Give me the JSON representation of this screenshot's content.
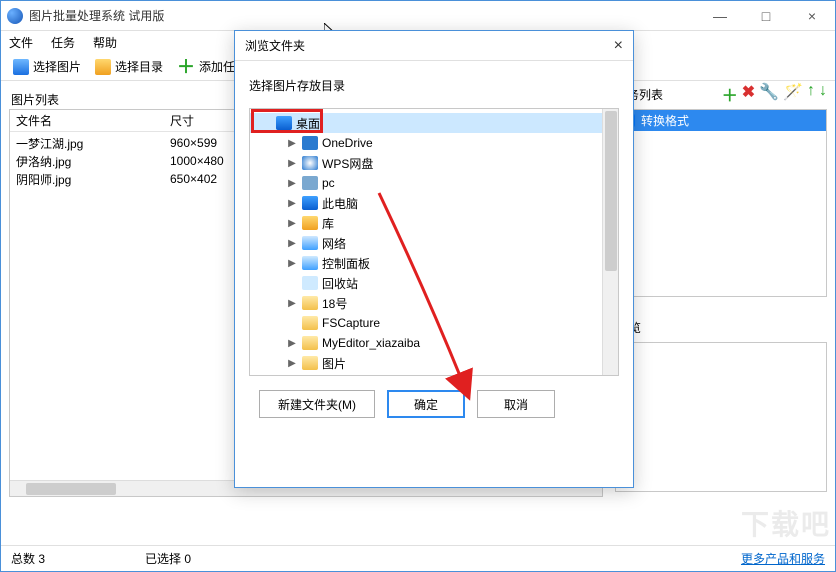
{
  "window": {
    "title": "图片批量处理系统 试用版",
    "min": "—",
    "max": "□",
    "close": "×"
  },
  "menubar": {
    "file": "文件",
    "task": "任务",
    "help": "帮助"
  },
  "toolbar": {
    "select_pic": "选择图片",
    "select_dir": "选择目录",
    "add_task": "添加任"
  },
  "left": {
    "section": "图片列表",
    "col1": "文件名",
    "col2": "尺寸",
    "rows": [
      {
        "name": "一梦江湖.jpg",
        "size": "960×599"
      },
      {
        "name": "伊洛纳.jpg",
        "size": "1000×480"
      },
      {
        "name": "阴阳师.jpg",
        "size": "650×402"
      }
    ]
  },
  "right": {
    "section": "任务列表",
    "task_item": "转换格式",
    "preview": "预览"
  },
  "dialog": {
    "title": "浏览文件夹",
    "close": "×",
    "prompt": "选择图片存放目录",
    "nodes": {
      "desktop": "桌面",
      "onedrive": "OneDrive",
      "wps": "WPS网盘",
      "pc_user": "pc",
      "this_pc": "此电脑",
      "library": "库",
      "network": "网络",
      "control": "控制面板",
      "recycle": "回收站",
      "f1": "18号",
      "f2": "FSCapture",
      "f3": "MyEditor_xiazaiba",
      "f4": "图片"
    },
    "new_folder": "新建文件夹(M)",
    "ok": "确定",
    "cancel": "取消"
  },
  "status": {
    "total": "总数  3",
    "selected": "已选择  0",
    "link": "更多产品和服务"
  },
  "watermark": "下载吧"
}
